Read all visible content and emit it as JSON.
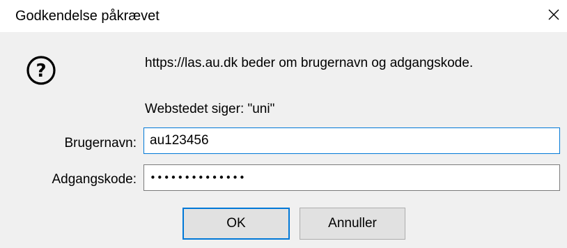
{
  "dialog": {
    "title": "Godkendelse påkrævet",
    "message": "https://las.au.dk beder om brugernavn og adgangskode.",
    "realm": "Webstedet siger: \"uni\"",
    "icon": "question-icon"
  },
  "form": {
    "username_label": "Brugernavn:",
    "username_value": "au123456",
    "password_label": "Adgangskode:",
    "password_value": "••••••••••••••"
  },
  "buttons": {
    "ok_label": "OK",
    "cancel_label": "Annuller"
  },
  "colors": {
    "accent": "#0078d7",
    "panel": "#f0f0f0",
    "button": "#e1e1e1"
  }
}
